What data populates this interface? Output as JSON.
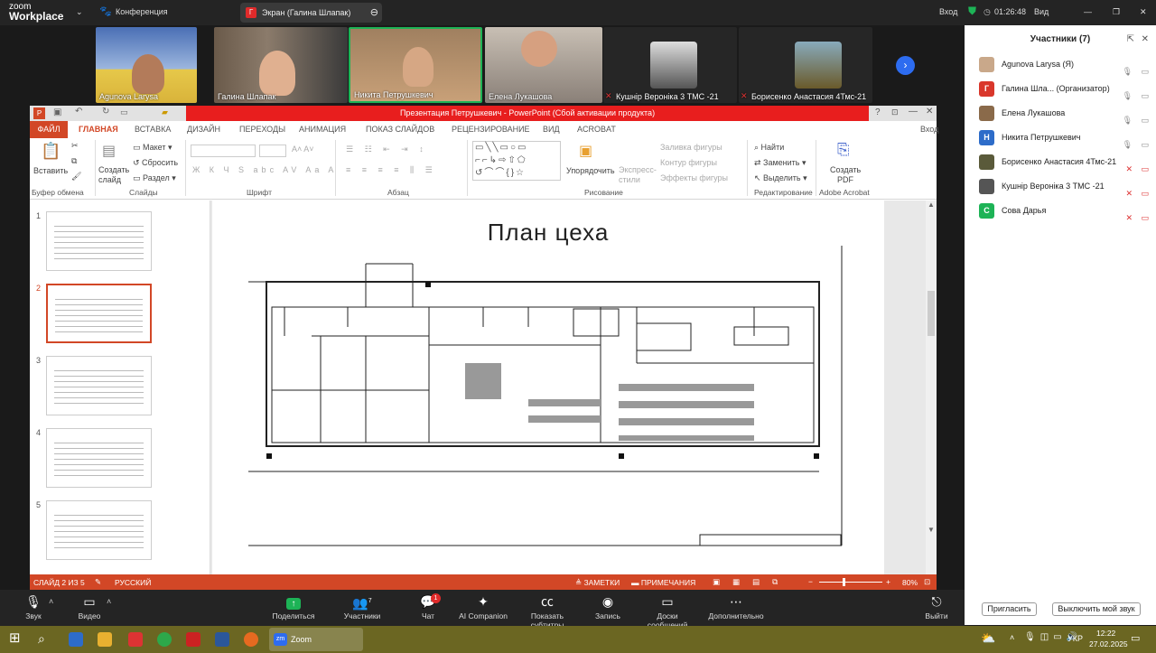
{
  "zoom": {
    "logo_top": "zoom",
    "logo_bottom": "Workplace",
    "meeting": "Конференция",
    "share_pill": "Экран (Галина Шлапак)",
    "share_initial": "Г",
    "login": "Вход",
    "timer": "01:26:48",
    "view": "Вид"
  },
  "strip": [
    {
      "name": "Agunova Larysa"
    },
    {
      "name": "Галина Шлапак"
    },
    {
      "name": "Никита Петрушкевич"
    },
    {
      "name": "Елена Лукашова"
    },
    {
      "name": "Кушнір Вероніка 3 ТМС -21"
    },
    {
      "name": "Борисенко Анастасия 4Тмс-21"
    }
  ],
  "panel": {
    "title": "Участники (7)",
    "participants": [
      {
        "name": "Agunova Larysa  (Я)",
        "initial": "",
        "color": "#c9a88a"
      },
      {
        "name": "Галина Шла...  (Организатор)",
        "initial": "Г",
        "color": "#d9372b"
      },
      {
        "name": "Елена Лукашова",
        "initial": "",
        "color": "#8a6a4a"
      },
      {
        "name": "Никита Петрушкевич",
        "initial": "Н",
        "color": "#2d6cc9"
      },
      {
        "name": "Борисенко Анастасия 4Тмс-21",
        "initial": "",
        "color": "#5a5a3a"
      },
      {
        "name": "Кушнір Вероніка 3 ТМС -21",
        "initial": "",
        "color": "#555555"
      },
      {
        "name": "Сова Дарья",
        "initial": "С",
        "color": "#1db356"
      }
    ],
    "invite": "Пригласить",
    "mute_me": "Выключить мой звук"
  },
  "ppt": {
    "title": "Презентация Петрушкевич -  PowerPoint (Сбой активации продукта)",
    "login": "Вход",
    "tabs": [
      "ФАЙЛ",
      "ГЛАВНАЯ",
      "ВСТАВКА",
      "ДИЗАЙН",
      "ПЕРЕХОДЫ",
      "АНИМАЦИЯ",
      "ПОКАЗ СЛАЙДОВ",
      "РЕЦЕНЗИРОВАНИЕ",
      "ВИД",
      "ACROBAT"
    ],
    "ribbon": {
      "paste": "Вставить",
      "new_slide": "Создать слайд",
      "layout": "Макет",
      "reset": "Сбросить",
      "section": "Раздел",
      "arrange": "Упорядочить",
      "express": "Экспресс-стили",
      "fill": "Заливка фигуры",
      "outline": "Контур фигуры",
      "effects": "Эффекты фигуры",
      "find": "Найти",
      "replace": "Заменить",
      "select": "Выделить",
      "create_pdf": "Создать PDF",
      "groups": [
        "Буфер обмена",
        "Слайды",
        "Шрифт",
        "Абзац",
        "Рисование",
        "Редактирование",
        "Adobe Acrobat"
      ]
    },
    "thumb_numbers": [
      "1",
      "2",
      "3",
      "4",
      "5"
    ],
    "slide_title": "План цеха",
    "status": {
      "slide": "СЛАЙД 2 ИЗ 5",
      "lang": "РУССКИЙ",
      "notes": "ЗАМЕТКИ",
      "comments": "ПРИМЕЧАНИЯ",
      "zoom": "80%"
    }
  },
  "toolbar": {
    "audio": "Звук",
    "video": "Видео",
    "share": "Поделиться",
    "participants": "Участники",
    "participants_count": "7",
    "chat": "Чат",
    "chat_badge": "1",
    "ai": "AI Companion",
    "cc": "Показать субтитры",
    "record": "Запись",
    "whiteboard": "Доски сообщений",
    "more": "Дополнительно",
    "leave": "Выйти"
  },
  "taskbar": {
    "zoom_app": "Zoom Конференция",
    "lang": "УКР",
    "time": "12:22",
    "date": "27.02.2025"
  },
  "colors": {
    "ppt_accent": "#d24726",
    "zoom_bg": "#242424",
    "title_red": "#e81e1e",
    "taskbar": "#6b6622"
  }
}
